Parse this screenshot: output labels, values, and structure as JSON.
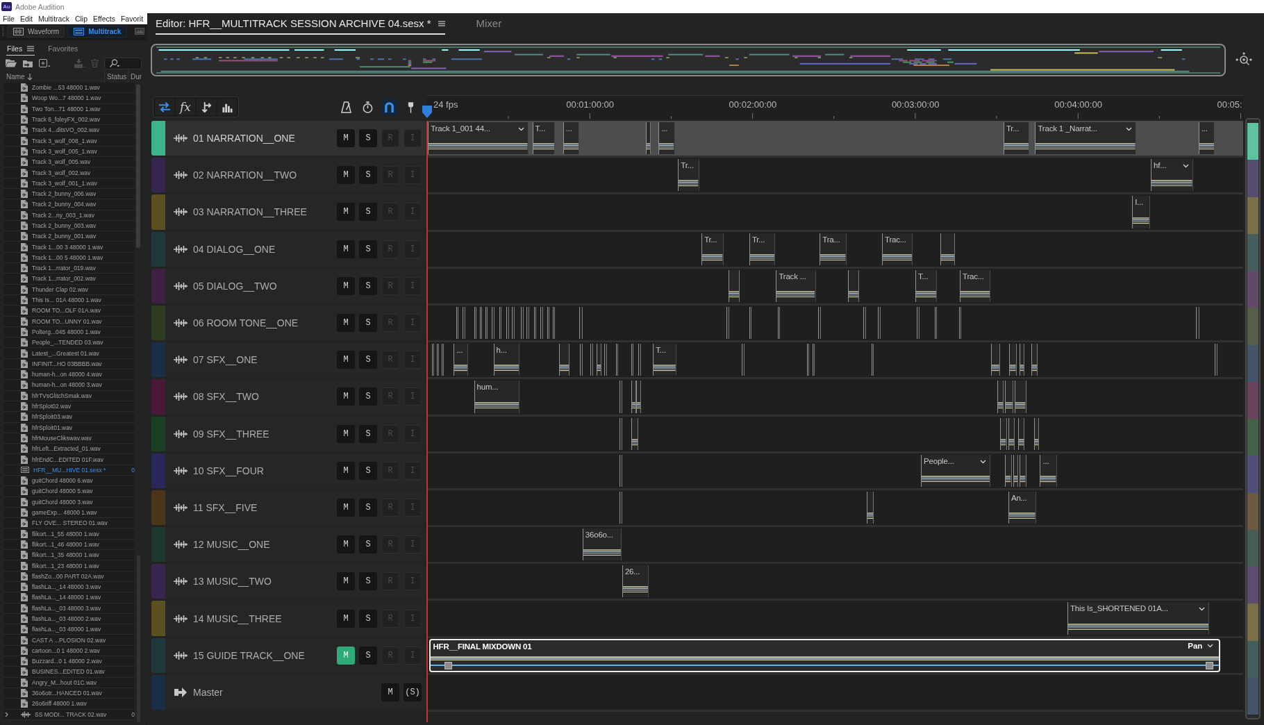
{
  "app": {
    "logo": "Au",
    "title": "Adobe Audition"
  },
  "menu": [
    "File",
    "Edit",
    "Multitrack",
    "Clip",
    "Effects",
    "Favorit"
  ],
  "workspaces": [
    {
      "label": "Waveform",
      "selected": false
    },
    {
      "label": "Multitrack",
      "selected": true
    }
  ],
  "files_panel": {
    "tabs": [
      {
        "label": "Files",
        "selected": true
      },
      {
        "label": "Favorites",
        "selected": false
      }
    ],
    "toolbar": [
      {
        "disabled": false
      },
      {
        "disabled": false
      },
      {
        "disabled": false
      },
      {
        "disabled": true
      },
      {
        "disabled": true
      }
    ],
    "columns": [
      "Name",
      "Status",
      "Dur"
    ],
    "files": [
      {
        "kind": "audio",
        "name": "Zombie ...53 48000 1.wav",
        "selected": false
      },
      {
        "kind": "audio",
        "name": "Woop Wo...7 48000 1.wav",
        "selected": false
      },
      {
        "kind": "audio",
        "name": "Two Ton...71 48000 1.wav",
        "selected": false
      },
      {
        "kind": "audio",
        "name": "Track 6_foleyFX_002.wav",
        "selected": false
      },
      {
        "kind": "audio",
        "name": "Track 4...ditsVO_002.wav",
        "selected": false
      },
      {
        "kind": "audio",
        "name": "Track 3_wolf_008_1.wav",
        "selected": false
      },
      {
        "kind": "audio",
        "name": "Track 3_wolf_005_1.wav",
        "selected": false
      },
      {
        "kind": "audio",
        "name": "Track 3_wolf_005.wav",
        "selected": false
      },
      {
        "kind": "audio",
        "name": "Track 3_wolf_002.wav",
        "selected": false
      },
      {
        "kind": "audio",
        "name": "Track 3_wolf_001_1.wav",
        "selected": false
      },
      {
        "kind": "audio",
        "name": "Track 2_bunny_006.wav",
        "selected": false
      },
      {
        "kind": "audio",
        "name": "Track 2_bunny_004.wav",
        "selected": false
      },
      {
        "kind": "audio",
        "name": "Track 2...ny_003_1.wav",
        "selected": false
      },
      {
        "kind": "audio",
        "name": "Track 2_bunny_003.wav",
        "selected": false
      },
      {
        "kind": "audio",
        "name": "Track 2_bunny_001.wav",
        "selected": false
      },
      {
        "kind": "audio",
        "name": "Track 1...00 3 48000 1.wav",
        "selected": false
      },
      {
        "kind": "audio",
        "name": "Track 1...00 5 48000 1.wav",
        "selected": false
      },
      {
        "kind": "audio",
        "name": "Track 1...rrator_019.wav",
        "selected": false
      },
      {
        "kind": "audio",
        "name": "Track 1...rrator_002.wav",
        "selected": false
      },
      {
        "kind": "audio",
        "name": "Thunder Clap 02.wav",
        "selected": false
      },
      {
        "kind": "audio",
        "name": "This Is... 01A 48000 1.wav",
        "selected": false
      },
      {
        "kind": "audio",
        "name": "ROOM TO...OLF 01A.wav",
        "selected": false
      },
      {
        "kind": "audio",
        "name": "ROOM TO...UNNY 01.wav",
        "selected": false
      },
      {
        "kind": "audio",
        "name": "Polterg...045 48000 1.wav",
        "selected": false
      },
      {
        "kind": "audio",
        "name": "People_...TENDED 03.wav",
        "selected": false
      },
      {
        "kind": "audio",
        "name": "Latest_...Greatest 01.wav",
        "selected": false
      },
      {
        "kind": "audio",
        "name": "INFINIT...HO 03BBBB.wav",
        "selected": false
      },
      {
        "kind": "audio",
        "name": "human-h...on 48000 4.wav",
        "selected": false
      },
      {
        "kind": "audio",
        "name": "human-h...on 48000 3.wav",
        "selected": false
      },
      {
        "kind": "audio",
        "name": "hfrTVsGlitchSmak.wav",
        "selected": false
      },
      {
        "kind": "audio",
        "name": "hfrSplot02.wav",
        "selected": false
      },
      {
        "kind": "audio",
        "name": "hfrSploit03.wav",
        "selected": false
      },
      {
        "kind": "audio",
        "name": "hfrSploit01.wav",
        "selected": false
      },
      {
        "kind": "audio",
        "name": "hfrMouseClikswav.wav",
        "selected": false
      },
      {
        "kind": "audio",
        "name": "hfrLeft...Extracted_01.wav",
        "selected": false
      },
      {
        "kind": "audio",
        "name": "hfrEndC...EDITED 01F.wav",
        "selected": false
      },
      {
        "kind": "session",
        "name": "HFR__MU...HIVE 01.sesx *",
        "selected": true,
        "duration": "0"
      },
      {
        "kind": "audio",
        "name": "guitChord 48000 6.wav",
        "selected": false
      },
      {
        "kind": "audio",
        "name": "guitChord 48000 5.wav",
        "selected": false
      },
      {
        "kind": "audio",
        "name": "guitChord 48000 3.wav",
        "selected": false
      },
      {
        "kind": "audio",
        "name": "gameExp... 48000 1.wav",
        "selected": false
      },
      {
        "kind": "audio",
        "name": "FLY OVE... STEREO 01.wav",
        "selected": false
      },
      {
        "kind": "audio",
        "name": "flikort...1_55 48000 1.wav",
        "selected": false
      },
      {
        "kind": "audio",
        "name": "flikort...1_46 48000 1.wav",
        "selected": false
      },
      {
        "kind": "audio",
        "name": "flikort...1_35 48000 1.wav",
        "selected": false
      },
      {
        "kind": "audio",
        "name": "flikort...1_23 48000 1.wav",
        "selected": false
      },
      {
        "kind": "audio",
        "name": "flashZo...00 PART 02A.wav",
        "selected": false
      },
      {
        "kind": "audio",
        "name": "flashLa..._14 48000 3.wav",
        "selected": false
      },
      {
        "kind": "audio",
        "name": "flashLa..._14 48000 1.wav",
        "selected": false
      },
      {
        "kind": "audio",
        "name": "flashLa..._03 48000 3.wav",
        "selected": false
      },
      {
        "kind": "audio",
        "name": "flashLa..._03 48000 2.wav",
        "selected": false
      },
      {
        "kind": "audio",
        "name": "flashLa..._03 48000 1.wav",
        "selected": false
      },
      {
        "kind": "audio",
        "name": "CAST A ...PLOSION 02.wav",
        "selected": false
      },
      {
        "kind": "audio",
        "name": "cartoon...0 1 48000 2.wav",
        "selected": false
      },
      {
        "kind": "audio",
        "name": "Buzzard...0 1 48000 2.wav",
        "selected": false
      },
      {
        "kind": "audio",
        "name": "BUSINES...EDITED 01.wav",
        "selected": false
      },
      {
        "kind": "audio",
        "name": "Angry_M...hout 01C.wav",
        "selected": false
      },
      {
        "kind": "audio",
        "name": "36o6otr...HANCED 01.wav",
        "selected": false
      },
      {
        "kind": "audio",
        "name": "26o6riff 48000 1.wav",
        "selected": false
      },
      {
        "kind": "group",
        "name": "SS MODI... TRACK 02.wav",
        "selected": false,
        "expanded": false,
        "duration": "0"
      }
    ]
  },
  "editor": {
    "tabs": [
      {
        "label": "Editor: HFR__MULTITRACK SESSION ARCHIVE 04.sesx *",
        "selected": true
      },
      {
        "label": "Mixer",
        "selected": false
      }
    ],
    "toolbar": [
      {
        "on": true
      },
      {
        "label": "fx",
        "on": false
      },
      {
        "on": false
      },
      {
        "on": false
      },
      {
        "on": false
      },
      {
        "on": false
      },
      {
        "on": true
      },
      {
        "on": false
      }
    ],
    "ruler": {
      "rate": "24 fps",
      "labels": [
        "00:01:00:00",
        "00:02:00:00",
        "00:03:00:00",
        "00:04:00:00",
        "00:05:"
      ]
    },
    "tracks": [
      {
        "kind": "audio",
        "name": "01 NARRATION__ONE",
        "color": "#3cb58c",
        "selected": true,
        "buttons": [
          {
            "label": "M",
            "on": false,
            "disabled": false
          },
          {
            "label": "S",
            "on": false,
            "disabled": false
          },
          {
            "label": "R",
            "on": false,
            "disabled": true
          },
          {
            "label": "I",
            "on": false,
            "disabled": true
          }
        ],
        "clips": [
          {
            "kind": "dropdown",
            "label": "Track 1_001 44...",
            "selected": false
          },
          {
            "kind": "named",
            "label": "T...",
            "selected": false
          },
          {
            "kind": "named",
            "label": "...",
            "selected": false
          },
          {
            "kind": "sliver",
            "selected": false
          },
          {
            "kind": "named",
            "label": "...",
            "selected": false
          },
          {
            "kind": "named",
            "label": "Tr...",
            "selected": false
          },
          {
            "kind": "dropdown",
            "label": "Track 1 _Narrat...",
            "selected": false
          },
          {
            "kind": "named",
            "label": "...",
            "selected": false
          }
        ]
      },
      {
        "kind": "audio",
        "name": "02 NARRATION__TWO",
        "color": "#35264f",
        "selected": false,
        "buttons": [
          {
            "label": "M",
            "on": false,
            "disabled": false
          },
          {
            "label": "S",
            "on": false,
            "disabled": false
          },
          {
            "label": "R",
            "on": false,
            "disabled": true
          },
          {
            "label": "I",
            "on": false,
            "disabled": true
          }
        ],
        "clips": [
          {
            "kind": "named",
            "label": "Tr...",
            "selected": false
          },
          {
            "kind": "dropdown",
            "label": "hf...",
            "selected": false
          }
        ]
      },
      {
        "kind": "audio",
        "name": "03 NARRATION__THREE",
        "color": "#5b5120",
        "selected": false,
        "buttons": [
          {
            "label": "M",
            "on": false,
            "disabled": false
          },
          {
            "label": "S",
            "on": false,
            "disabled": false
          },
          {
            "label": "R",
            "on": false,
            "disabled": true
          },
          {
            "label": "I",
            "on": false,
            "disabled": true
          }
        ],
        "clips": [
          {
            "kind": "named",
            "label": "I...",
            "selected": false
          }
        ]
      },
      {
        "kind": "audio",
        "name": "04 DIALOG__ONE",
        "color": "#1d3a39",
        "selected": false,
        "buttons": [
          {
            "label": "M",
            "on": false,
            "disabled": false
          },
          {
            "label": "S",
            "on": false,
            "disabled": false
          },
          {
            "label": "R",
            "on": false,
            "disabled": true
          },
          {
            "label": "I",
            "on": false,
            "disabled": true
          }
        ],
        "clips": [
          {
            "kind": "named",
            "label": "Tr...",
            "selected": false
          },
          {
            "kind": "named",
            "label": "Tr...",
            "selected": false
          },
          {
            "kind": "named",
            "label": "Tra...",
            "selected": false
          },
          {
            "kind": "named",
            "label": "Trac...",
            "selected": false
          },
          {
            "kind": "sliver",
            "selected": false
          }
        ]
      },
      {
        "kind": "audio",
        "name": "05 DIALOG__TWO",
        "color": "#3f2146",
        "selected": false,
        "buttons": [
          {
            "label": "M",
            "on": false,
            "disabled": false
          },
          {
            "label": "S",
            "on": false,
            "disabled": false
          },
          {
            "label": "R",
            "on": false,
            "disabled": true
          },
          {
            "label": "I",
            "on": false,
            "disabled": true
          }
        ],
        "clips": [
          {
            "kind": "sliver",
            "selected": false
          },
          {
            "kind": "named",
            "label": "Track ...",
            "selected": false
          },
          {
            "kind": "sliver",
            "selected": false
          },
          {
            "kind": "named",
            "label": "T...",
            "selected": false
          },
          {
            "kind": "named",
            "label": "Trac...",
            "selected": false
          }
        ]
      },
      {
        "kind": "audio",
        "name": "06 ROOM TONE__ONE",
        "color": "#2e3b21",
        "selected": false,
        "buttons": [
          {
            "label": "M",
            "on": false,
            "disabled": false
          },
          {
            "label": "S",
            "on": false,
            "disabled": false
          },
          {
            "label": "R",
            "on": false,
            "disabled": true
          },
          {
            "label": "I",
            "on": false,
            "disabled": true
          }
        ],
        "clips": [
          {
            "kind": "sliver",
            "selected": false
          },
          {
            "kind": "sliver",
            "selected": false
          },
          {
            "kind": "sliver",
            "selected": false
          },
          {
            "kind": "sliver",
            "selected": false
          },
          {
            "kind": "sliver",
            "selected": false
          },
          {
            "kind": "sliver",
            "selected": false
          },
          {
            "kind": "sliver",
            "selected": false
          },
          {
            "kind": "sliver",
            "selected": false
          },
          {
            "kind": "sliver",
            "selected": false
          },
          {
            "kind": "sliver",
            "selected": false
          },
          {
            "kind": "sliver",
            "selected": false
          },
          {
            "kind": "sliver",
            "selected": false
          },
          {
            "kind": "sliver",
            "selected": false
          },
          {
            "kind": "sliver",
            "selected": false
          },
          {
            "kind": "sliver",
            "selected": false
          },
          {
            "kind": "sliver",
            "selected": false
          },
          {
            "kind": "sliver",
            "selected": false
          },
          {
            "kind": "sliver",
            "selected": false
          },
          {
            "kind": "sliver",
            "selected": false
          },
          {
            "kind": "sliver",
            "selected": false
          },
          {
            "kind": "sliver",
            "selected": false
          },
          {
            "kind": "sliver",
            "selected": false
          },
          {
            "kind": "sliver",
            "selected": false
          },
          {
            "kind": "sliver",
            "selected": false
          },
          {
            "kind": "sliver",
            "selected": false
          },
          {
            "kind": "sliver",
            "selected": false
          }
        ]
      },
      {
        "kind": "audio",
        "name": "07 SFX__ONE",
        "color": "#1b2e48",
        "selected": false,
        "buttons": [
          {
            "label": "M",
            "on": false,
            "disabled": false
          },
          {
            "label": "S",
            "on": false,
            "disabled": false
          },
          {
            "label": "R",
            "on": false,
            "disabled": true
          },
          {
            "label": "I",
            "on": false,
            "disabled": true
          }
        ],
        "clips": [
          {
            "kind": "sliver",
            "selected": false
          },
          {
            "kind": "sliver",
            "selected": false
          },
          {
            "kind": "sliver",
            "selected": false
          },
          {
            "kind": "named",
            "label": "...",
            "selected": false
          },
          {
            "kind": "named",
            "label": "h...",
            "selected": false
          },
          {
            "kind": "sliver",
            "selected": false
          },
          {
            "kind": "sliver",
            "selected": false
          },
          {
            "kind": "sliver",
            "selected": false
          },
          {
            "kind": "sliver",
            "selected": false
          },
          {
            "kind": "sliver",
            "selected": false
          },
          {
            "kind": "sliver",
            "selected": false
          },
          {
            "kind": "sliver",
            "selected": false
          },
          {
            "kind": "sliver",
            "selected": false
          },
          {
            "kind": "named",
            "label": "T...",
            "selected": false
          },
          {
            "kind": "sliver",
            "selected": false
          },
          {
            "kind": "sliver",
            "selected": false
          },
          {
            "kind": "sliver",
            "selected": false
          },
          {
            "kind": "sliver",
            "selected": false
          },
          {
            "kind": "sliver",
            "selected": false
          },
          {
            "kind": "sliver",
            "selected": false
          },
          {
            "kind": "sliver",
            "selected": false
          },
          {
            "kind": "sliver",
            "selected": false
          },
          {
            "kind": "sliver",
            "selected": false
          }
        ]
      },
      {
        "kind": "audio",
        "name": "08 SFX__TWO",
        "color": "#4a1838",
        "selected": false,
        "buttons": [
          {
            "label": "M",
            "on": false,
            "disabled": false
          },
          {
            "label": "S",
            "on": false,
            "disabled": false
          },
          {
            "label": "R",
            "on": false,
            "disabled": true
          },
          {
            "label": "I",
            "on": false,
            "disabled": true
          }
        ],
        "clips": [
          {
            "kind": "named",
            "label": "hum...",
            "selected": false
          },
          {
            "kind": "sliver",
            "selected": false
          },
          {
            "kind": "sliver",
            "selected": false
          },
          {
            "kind": "sliver",
            "selected": false
          },
          {
            "kind": "sliver",
            "selected": false
          },
          {
            "kind": "sliver",
            "selected": false
          },
          {
            "kind": "sliver",
            "selected": false
          }
        ]
      },
      {
        "kind": "audio",
        "name": "09 SFX__THREE",
        "color": "#1b3f22",
        "selected": false,
        "buttons": [
          {
            "label": "M",
            "on": false,
            "disabled": false
          },
          {
            "label": "S",
            "on": false,
            "disabled": false
          },
          {
            "label": "R",
            "on": false,
            "disabled": true
          },
          {
            "label": "I",
            "on": false,
            "disabled": true
          }
        ],
        "clips": [
          {
            "kind": "sliver",
            "selected": false
          },
          {
            "kind": "sliver",
            "selected": false
          },
          {
            "kind": "sliver",
            "selected": false
          },
          {
            "kind": "sliver",
            "selected": false
          },
          {
            "kind": "sliver",
            "selected": false
          },
          {
            "kind": "sliver",
            "selected": false
          }
        ]
      },
      {
        "kind": "audio",
        "name": "10 SFX__FOUR",
        "color": "#2a285a",
        "selected": false,
        "buttons": [
          {
            "label": "M",
            "on": false,
            "disabled": false
          },
          {
            "label": "S",
            "on": false,
            "disabled": false
          },
          {
            "label": "R",
            "on": false,
            "disabled": true
          },
          {
            "label": "I",
            "on": false,
            "disabled": true
          }
        ],
        "clips": [
          {
            "kind": "sliver",
            "selected": false
          },
          {
            "kind": "dropdown",
            "label": "People...",
            "selected": false
          },
          {
            "kind": "sliver",
            "selected": false
          },
          {
            "kind": "sliver",
            "selected": false
          },
          {
            "kind": "sliver",
            "selected": false
          },
          {
            "kind": "named",
            "label": "...",
            "selected": false
          }
        ]
      },
      {
        "kind": "audio",
        "name": "11 SFX__FIVE",
        "color": "#4c3417",
        "selected": false,
        "buttons": [
          {
            "label": "M",
            "on": false,
            "disabled": false
          },
          {
            "label": "S",
            "on": false,
            "disabled": false
          },
          {
            "label": "R",
            "on": false,
            "disabled": true
          },
          {
            "label": "I",
            "on": false,
            "disabled": true
          }
        ],
        "clips": [
          {
            "kind": "sliver",
            "selected": false
          },
          {
            "kind": "sliver",
            "selected": false
          },
          {
            "kind": "named",
            "label": "An...",
            "selected": false
          }
        ]
      },
      {
        "kind": "audio",
        "name": "12 MUSIC__ONE",
        "color": "#1d392d",
        "selected": false,
        "buttons": [
          {
            "label": "M",
            "on": false,
            "disabled": false
          },
          {
            "label": "S",
            "on": false,
            "disabled": false
          },
          {
            "label": "R",
            "on": false,
            "disabled": true
          },
          {
            "label": "I",
            "on": false,
            "disabled": true
          }
        ],
        "clips": [
          {
            "kind": "named",
            "label": "36o6o...",
            "selected": false
          }
        ]
      },
      {
        "kind": "audio",
        "name": "13 MUSIC__TWO",
        "color": "#38264f",
        "selected": false,
        "buttons": [
          {
            "label": "M",
            "on": false,
            "disabled": false
          },
          {
            "label": "S",
            "on": false,
            "disabled": false
          },
          {
            "label": "R",
            "on": false,
            "disabled": true
          },
          {
            "label": "I",
            "on": false,
            "disabled": true
          }
        ],
        "clips": [
          {
            "kind": "named",
            "label": "26...",
            "selected": false
          }
        ]
      },
      {
        "kind": "audio",
        "name": "14 MUSIC__THREE",
        "color": "#5b5120",
        "selected": false,
        "buttons": [
          {
            "label": "M",
            "on": false,
            "disabled": false
          },
          {
            "label": "S",
            "on": false,
            "disabled": false
          },
          {
            "label": "R",
            "on": false,
            "disabled": true
          },
          {
            "label": "I",
            "on": false,
            "disabled": true
          }
        ],
        "clips": [
          {
            "kind": "dropdown",
            "label": "This Is_SHORTENED 01A...",
            "selected": false
          }
        ]
      },
      {
        "kind": "audio",
        "name": "15 GUIDE TRACK__ONE",
        "color": "#1d3a39",
        "selected": false,
        "buttons": [
          {
            "label": "M",
            "on": true,
            "disabled": false
          },
          {
            "label": "S",
            "on": false,
            "disabled": false
          },
          {
            "label": "R",
            "on": false,
            "disabled": true
          },
          {
            "label": "I",
            "on": false,
            "disabled": true
          }
        ],
        "clips": [
          {
            "kind": "dropdown",
            "label": "HFR__FINAL MIXDOWN 01",
            "envelope": "Pan",
            "selected": true
          }
        ]
      },
      {
        "kind": "master",
        "name": "Master",
        "color": "#1b2e48",
        "selected": false,
        "buttons": [
          {
            "label": "M",
            "on": false,
            "disabled": false
          },
          {
            "label": "(S)",
            "on": false,
            "disabled": false
          }
        ]
      }
    ]
  }
}
